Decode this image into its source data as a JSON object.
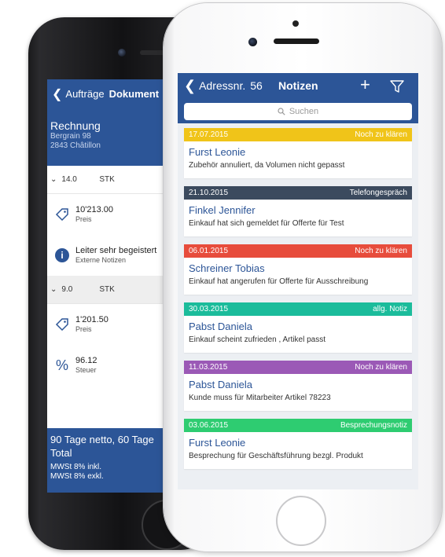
{
  "back_screen": {
    "nav": {
      "back_label": "Aufträge",
      "title": "Dokument"
    },
    "header": {
      "title": "Rechnung",
      "address_line1": "Bergrain 98",
      "address_line2": "2843 Châtillon"
    },
    "lines": [
      {
        "qty": "14.0",
        "unit": "STK"
      },
      {
        "qty": "9.0",
        "unit": "STK"
      }
    ],
    "items": [
      {
        "value": "10'213.00",
        "label": "Preis",
        "icon": "price-tag-icon"
      },
      {
        "value": "Leiter sehr begeistert",
        "label": "Externe Notizen",
        "icon": "info-icon"
      },
      {
        "value": "1'201.50",
        "label": "Preis",
        "icon": "price-tag-icon"
      },
      {
        "value": "96.12",
        "label": "Steuer",
        "icon": "percent-icon"
      }
    ],
    "footer": {
      "terms": "90 Tage netto, 60 Tage",
      "total_label": "Total",
      "vat_incl": "MWSt 8% inkl.",
      "vat_excl": "MWSt 8% exkl."
    }
  },
  "front_screen": {
    "nav": {
      "back_label": "Adressnr.",
      "address_number": "56",
      "title": "Notizen",
      "add_icon": "plus-icon",
      "filter_icon": "filter-icon"
    },
    "search": {
      "placeholder": "Suchen",
      "icon": "search-icon"
    },
    "notes": [
      {
        "date": "17.07.2015",
        "category": "Noch zu klären",
        "color": "#f0c419",
        "name": "Furst Leonie",
        "text": "Zubehör annuliert, da Volumen nicht gepasst"
      },
      {
        "date": "21.10.2015",
        "category": "Telefongespräch",
        "color": "#3b4a5e",
        "name": "Finkel Jennifer",
        "text": "Einkauf hat sich gemeldet für Offerte für Test"
      },
      {
        "date": "06.01.2015",
        "category": "Noch zu klären",
        "color": "#e74c3c",
        "name": "Schreiner Tobias",
        "text": "Einkauf hat angerufen für Offerte für Ausschreibung"
      },
      {
        "date": "30.03.2015",
        "category": "allg. Notiz",
        "color": "#1bbc9b",
        "name": "Pabst Daniela",
        "text": "Einkauf scheint zufrieden , Artikel passt"
      },
      {
        "date": "11.03.2015",
        "category": "Noch zu klären",
        "color": "#9b59b6",
        "name": "Pabst Daniela",
        "text": "Kunde muss für Mitarbeiter Artikel 78223"
      },
      {
        "date": "03.06.2015",
        "category": "Besprechungsnotiz",
        "color": "#2ecc71",
        "name": "Furst Leonie",
        "text": "Besprechung für Geschäftsführung bezgl. Produkt"
      }
    ]
  },
  "colors": {
    "brand_blue": "#2c5597"
  }
}
